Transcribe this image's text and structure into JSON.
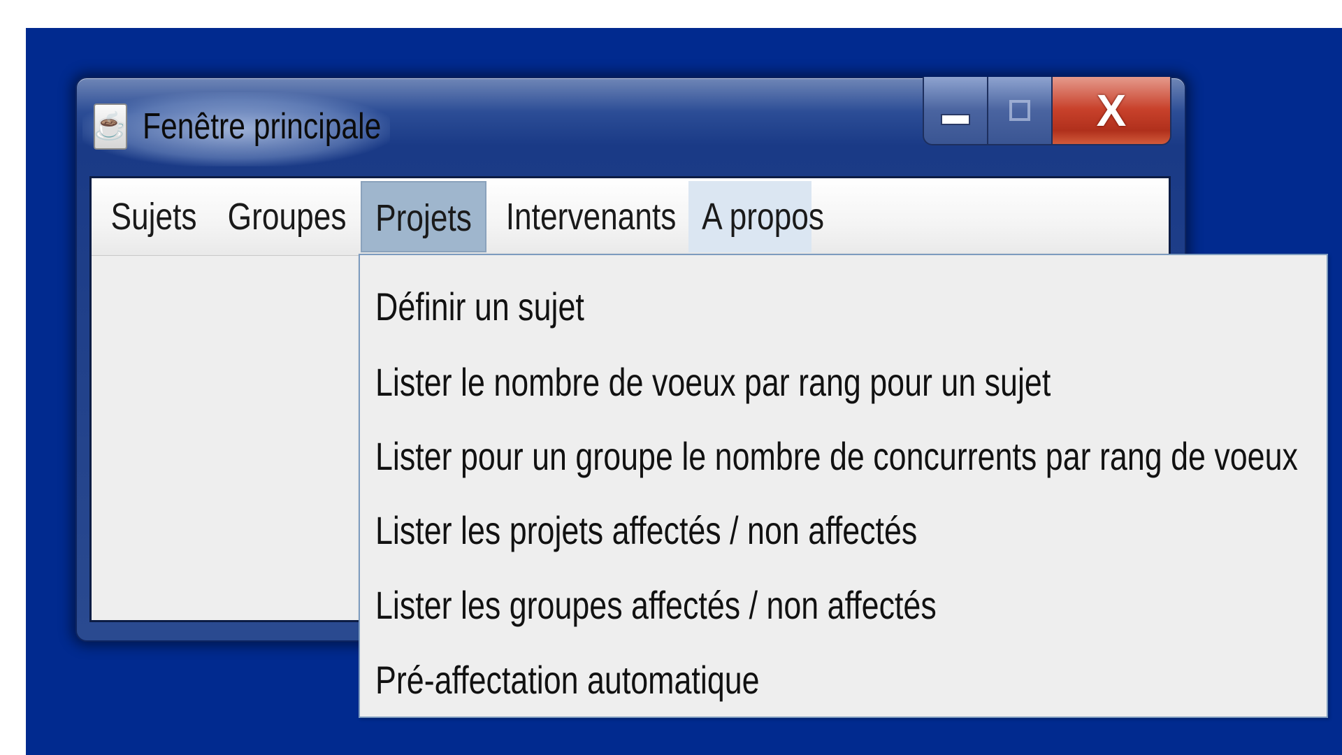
{
  "window": {
    "title": "Fenêtre principale",
    "icon": "java-icon"
  },
  "caption": {
    "minimize_icon": "minimize-icon",
    "maximize_icon": "maximize-icon",
    "close_label": "X"
  },
  "menubar": {
    "items": [
      {
        "label": "Sujets",
        "state": "normal"
      },
      {
        "label": "Groupes",
        "state": "normal"
      },
      {
        "label": "Projets",
        "state": "open"
      },
      {
        "label": "Intervenants",
        "state": "normal"
      },
      {
        "label": "A propos",
        "state": "hover"
      }
    ]
  },
  "dropdown": {
    "items": [
      {
        "label": "Définir un sujet"
      },
      {
        "label": "Lister le nombre de voeux par rang pour un sujet"
      },
      {
        "label": "Lister pour un groupe le nombre de concurrents par rang de voeux"
      },
      {
        "label": "Lister les projets affectés / non affectés"
      },
      {
        "label": "Lister les groupes affectés / non affectés"
      },
      {
        "label": "Pré-affectation automatique"
      }
    ]
  },
  "colors": {
    "desktop": "#012a8f",
    "menu_active": "#9fb6cd",
    "menu_hover": "#dbe6f2",
    "close_button": "#c8412b"
  }
}
